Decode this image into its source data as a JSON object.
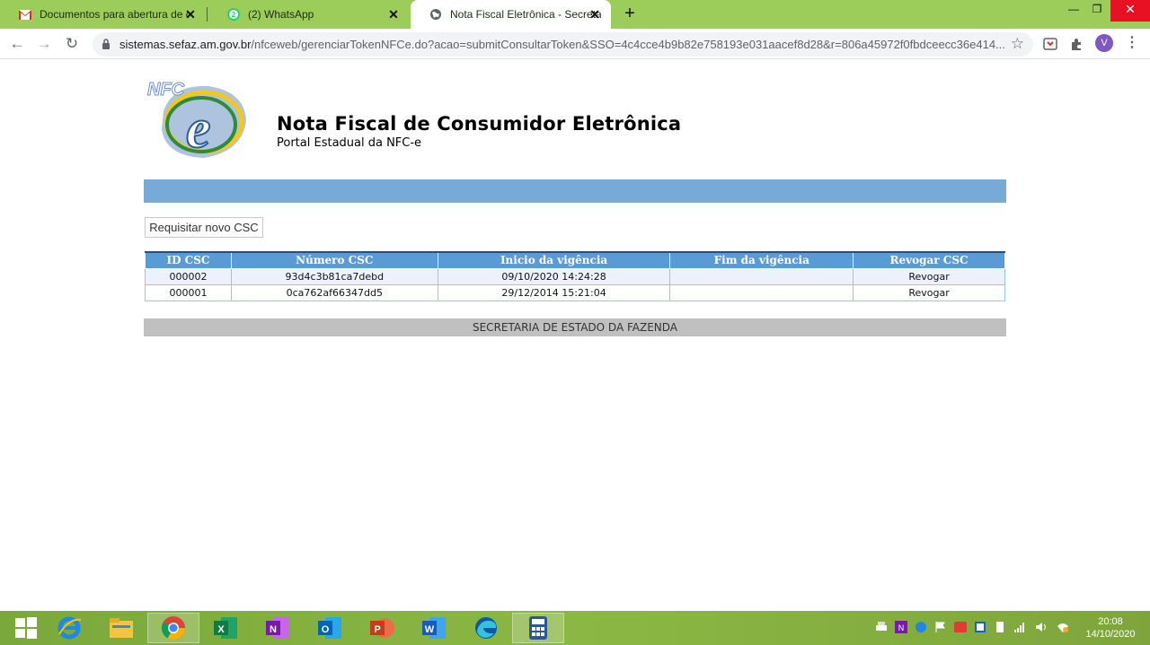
{
  "browser": {
    "tabs": [
      {
        "title": "Documentos para abertura de co",
        "icon": "gmail-icon"
      },
      {
        "title": "(2) WhatsApp",
        "icon": "whatsapp-icon"
      },
      {
        "title": "Nota Fiscal Eletrônica - Secretaria",
        "icon": "globe-icon"
      }
    ],
    "url_host": "sistemas.sefaz.am.gov.br",
    "url_path": "/nfceweb/gerenciarTokenNFCe.do?acao=submitConsultarToken&SSO=4c4cce4b9b82e758193e031aacef8d28&r=806a45972f0fbdceecc36e414...",
    "avatar_letter": "V"
  },
  "page": {
    "logo_text": "NFC",
    "logo_letter": "e",
    "title": "Nota Fiscal de Consumidor Eletrônica",
    "subtitle": "Portal Estadual da NFC-e",
    "request_button": "Requisitar novo CSC",
    "table": {
      "headers": [
        "ID CSC",
        "Número CSC",
        "Inicio da vigência",
        "Fim da vigência",
        "Revogar CSC"
      ],
      "rows": [
        [
          "000002",
          "93d4c3b81ca7debd",
          "09/10/2020 14:24:28",
          "",
          "Revogar"
        ],
        [
          "000001",
          "0ca762af66347dd5",
          "29/12/2014 15:21:04",
          "",
          "Revogar"
        ]
      ]
    },
    "footer": "SECRETARIA DE ESTADO DA FAZENDA"
  },
  "taskbar": {
    "apps": [
      "windows-start-icon",
      "internet-explorer-icon",
      "file-explorer-icon",
      "chrome-icon",
      "excel-icon",
      "onenote-icon",
      "outlook-icon",
      "powerpoint-icon",
      "word-icon",
      "edge-icon",
      "calculator-icon"
    ],
    "time": "20:08",
    "date": "14/10/2020"
  },
  "colors": {
    "tabbar": "#9ccc5a",
    "header_bar": "#78aad8",
    "table_header": "#5b9bd5",
    "footer": "#c0c0c0"
  }
}
